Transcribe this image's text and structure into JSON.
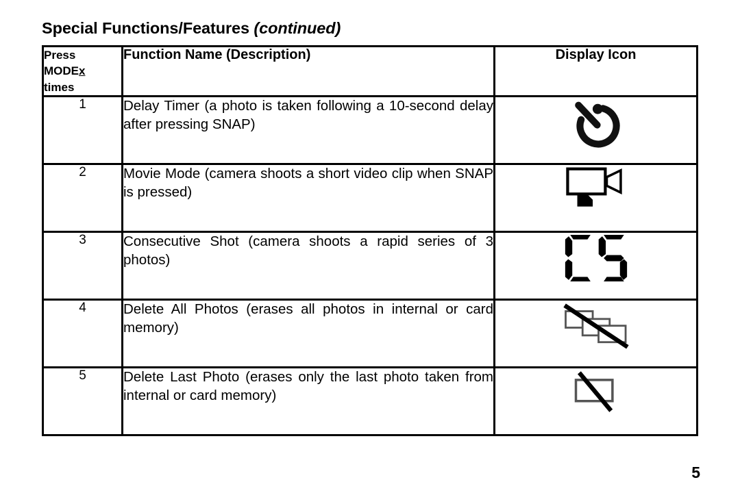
{
  "heading": {
    "main": "Special Functions/Features ",
    "continued": "(continued)"
  },
  "table": {
    "headers": {
      "press_line1": "Press",
      "press_mode": "MODE",
      "press_x": "x",
      "press_line3": "times",
      "description": "Function Name (Description)",
      "display_icon": "Display Icon"
    },
    "rows": [
      {
        "press_count": "1",
        "description": "Delay Timer (a photo is taken following a 10-second delay after pressing SNAP)",
        "icon": "delay-timer-icon"
      },
      {
        "press_count": "2",
        "description": "Movie Mode (camera shoots a short video clip when SNAP is pressed)",
        "icon": "movie-camera-icon"
      },
      {
        "press_count": "3",
        "description": "Consecutive Shot (camera shoots a rapid series of 3 photos)",
        "icon": "cs-seven-segment-icon"
      },
      {
        "press_count": "4",
        "description": "Delete All Photos (erases all photos in internal or card memory)",
        "icon": "delete-all-photos-icon"
      },
      {
        "press_count": "5",
        "description": "Delete Last Photo (erases only the last photo taken from internal or card memory)",
        "icon": "delete-last-photo-icon"
      }
    ]
  },
  "footer": {
    "page_number": "5"
  },
  "colors": {
    "ink": "#000000",
    "paper": "#ffffff"
  }
}
